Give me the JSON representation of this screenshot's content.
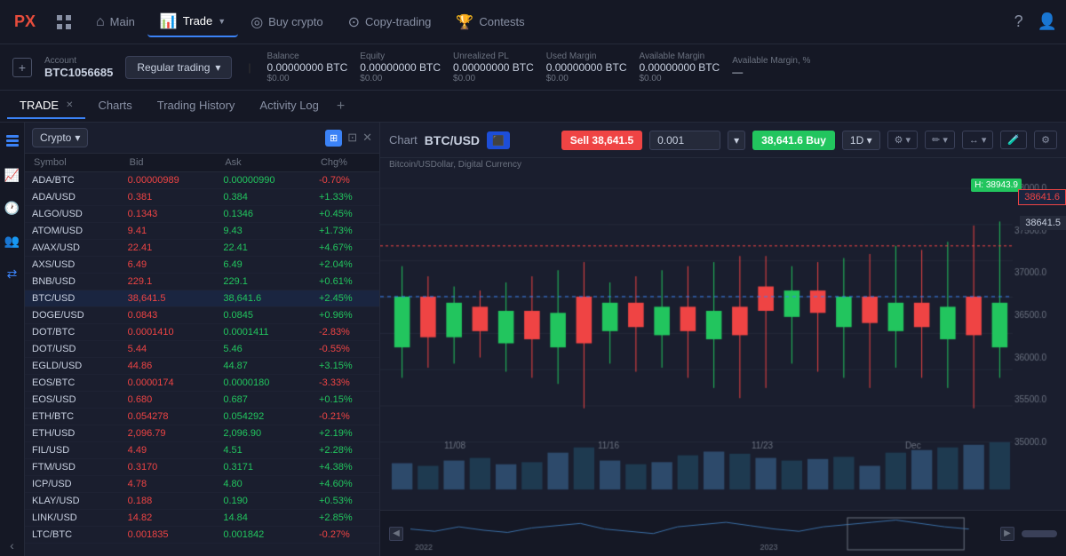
{
  "nav": {
    "logo": "PX",
    "items": [
      {
        "label": "Main",
        "icon": "⌂",
        "active": false
      },
      {
        "label": "Trade",
        "icon": "📊",
        "active": true
      },
      {
        "label": "Buy crypto",
        "icon": "◎",
        "active": false
      },
      {
        "label": "Copy-trading",
        "icon": "⊙",
        "active": false
      },
      {
        "label": "Contests",
        "icon": "🏆",
        "active": false
      }
    ]
  },
  "account": {
    "label": "Account",
    "id": "BTC1056685",
    "trading_type": "Regular trading",
    "metrics": [
      {
        "label": "Balance",
        "value": "0.00000000 BTC",
        "usd": "$0.00"
      },
      {
        "label": "Equity",
        "value": "0.00000000 BTC",
        "usd": "$0.00"
      },
      {
        "label": "Unrealized PL",
        "value": "0.00000000 BTC",
        "usd": "$0.00"
      },
      {
        "label": "Used Margin",
        "value": "0.00000000 BTC",
        "usd": "$0.00"
      },
      {
        "label": "Available Margin",
        "value": "0.00000000 BTC",
        "usd": "$0.00"
      },
      {
        "label": "Available Margin, %",
        "value": "—"
      }
    ]
  },
  "tabs": [
    {
      "label": "TRADE",
      "closable": true,
      "active": true
    },
    {
      "label": "Charts",
      "closable": false,
      "active": false
    },
    {
      "label": "Trading History",
      "closable": false,
      "active": false
    },
    {
      "label": "Activity Log",
      "closable": false,
      "active": false
    }
  ],
  "symbol_panel": {
    "category": "Crypto",
    "headers": [
      "Symbol",
      "Bid",
      "Ask",
      "Chg%"
    ],
    "rows": [
      {
        "symbol": "ADA/BTC",
        "bid": "0.00000989",
        "ask": "0.00000990",
        "chg": "-0.70%",
        "positive": false,
        "active": false
      },
      {
        "symbol": "ADA/USD",
        "bid": "0.381",
        "ask": "0.384",
        "chg": "+1.33%",
        "positive": true,
        "active": false
      },
      {
        "symbol": "ALGO/USD",
        "bid": "0.1343",
        "ask": "0.1346",
        "chg": "+0.45%",
        "positive": true,
        "active": false
      },
      {
        "symbol": "ATOM/USD",
        "bid": "9.41",
        "ask": "9.43",
        "chg": "+1.73%",
        "positive": true,
        "active": false
      },
      {
        "symbol": "AVAX/USD",
        "bid": "22.41",
        "ask": "22.41",
        "chg": "+4.67%",
        "positive": true,
        "active": false
      },
      {
        "symbol": "AXS/USD",
        "bid": "6.49",
        "ask": "6.49",
        "chg": "+2.04%",
        "positive": true,
        "active": false
      },
      {
        "symbol": "BNB/USD",
        "bid": "229.1",
        "ask": "229.1",
        "chg": "+0.61%",
        "positive": true,
        "active": false
      },
      {
        "symbol": "BTC/USD",
        "bid": "38,641.5",
        "ask": "38,641.6",
        "chg": "+2.45%",
        "positive": true,
        "active": true
      },
      {
        "symbol": "DOGE/USD",
        "bid": "0.0843",
        "ask": "0.0845",
        "chg": "+0.96%",
        "positive": true,
        "active": false
      },
      {
        "symbol": "DOT/BTC",
        "bid": "0.0001410",
        "ask": "0.0001411",
        "chg": "-2.83%",
        "positive": false,
        "active": false
      },
      {
        "symbol": "DOT/USD",
        "bid": "5.44",
        "ask": "5.46",
        "chg": "-0.55%",
        "positive": false,
        "active": false
      },
      {
        "symbol": "EGLD/USD",
        "bid": "44.86",
        "ask": "44.87",
        "chg": "+3.15%",
        "positive": true,
        "active": false
      },
      {
        "symbol": "EOS/BTC",
        "bid": "0.0000174",
        "ask": "0.0000180",
        "chg": "-3.33%",
        "positive": false,
        "active": false
      },
      {
        "symbol": "EOS/USD",
        "bid": "0.680",
        "ask": "0.687",
        "chg": "+0.15%",
        "positive": true,
        "active": false
      },
      {
        "symbol": "ETH/BTC",
        "bid": "0.054278",
        "ask": "0.054292",
        "chg": "-0.21%",
        "positive": false,
        "active": false
      },
      {
        "symbol": "ETH/USD",
        "bid": "2,096.79",
        "ask": "2,096.90",
        "chg": "+2.19%",
        "positive": true,
        "active": false
      },
      {
        "symbol": "FIL/USD",
        "bid": "4.49",
        "ask": "4.51",
        "chg": "+2.28%",
        "positive": true,
        "active": false
      },
      {
        "symbol": "FTM/USD",
        "bid": "0.3170",
        "ask": "0.3171",
        "chg": "+4.38%",
        "positive": true,
        "active": false
      },
      {
        "symbol": "ICP/USD",
        "bid": "4.78",
        "ask": "4.80",
        "chg": "+4.60%",
        "positive": true,
        "active": false
      },
      {
        "symbol": "KLAY/USD",
        "bid": "0.188",
        "ask": "0.190",
        "chg": "+0.53%",
        "positive": true,
        "active": false
      },
      {
        "symbol": "LINK/USD",
        "bid": "14.82",
        "ask": "14.84",
        "chg": "+2.85%",
        "positive": true,
        "active": false
      },
      {
        "symbol": "LTC/BTC",
        "bid": "0.001835",
        "ask": "0.001842",
        "chg": "-0.27%",
        "positive": false,
        "active": false
      }
    ]
  },
  "chart": {
    "title": "Chart",
    "symbol": "BTC/USD",
    "subtitle": "Bitcoin/USDollar, Digital Currency",
    "sell_price": "38,641.5",
    "buy_price": "38,641.6",
    "amount": "0.001",
    "timeframe": "1D",
    "price_high": "H: 38943.9",
    "price_tag1": "38641.6",
    "price_tag2": "38641.5",
    "x_labels": [
      "11/08",
      "11/16",
      "11/23",
      "Dec"
    ],
    "y_labels": [
      "38000.0",
      "37500.0",
      "37000.0",
      "36500.0",
      "36000.0",
      "35500.0",
      "35000.0"
    ],
    "bottom_labels": [
      "2022",
      "2023"
    ],
    "candles": [
      {
        "open": 55,
        "close": 80,
        "high": 40,
        "low": 95,
        "green": true
      },
      {
        "open": 75,
        "close": 55,
        "high": 45,
        "low": 90,
        "green": false
      },
      {
        "open": 58,
        "close": 75,
        "high": 50,
        "low": 88,
        "green": true
      },
      {
        "open": 72,
        "close": 60,
        "high": 52,
        "low": 85,
        "green": false
      },
      {
        "open": 62,
        "close": 78,
        "high": 48,
        "low": 92,
        "green": true
      },
      {
        "open": 76,
        "close": 62,
        "high": 45,
        "low": 95,
        "green": false
      },
      {
        "open": 63,
        "close": 80,
        "high": 42,
        "low": 98,
        "green": true
      },
      {
        "open": 78,
        "close": 55,
        "high": 38,
        "low": 110,
        "green": false
      },
      {
        "open": 58,
        "close": 72,
        "high": 48,
        "low": 88,
        "green": true
      },
      {
        "open": 70,
        "close": 58,
        "high": 45,
        "low": 92,
        "green": false
      },
      {
        "open": 60,
        "close": 74,
        "high": 42,
        "low": 90,
        "green": true
      },
      {
        "open": 72,
        "close": 60,
        "high": 40,
        "low": 95,
        "green": false
      },
      {
        "open": 62,
        "close": 76,
        "high": 38,
        "low": 100,
        "green": true
      },
      {
        "open": 74,
        "close": 60,
        "high": 35,
        "low": 105,
        "green": false
      },
      {
        "open": 62,
        "close": 50,
        "high": 35,
        "low": 100,
        "green": false
      },
      {
        "open": 52,
        "close": 65,
        "high": 40,
        "low": 88,
        "green": true
      },
      {
        "open": 63,
        "close": 52,
        "high": 38,
        "low": 92,
        "green": false
      },
      {
        "open": 55,
        "close": 70,
        "high": 36,
        "low": 95,
        "green": true
      },
      {
        "open": 68,
        "close": 55,
        "high": 34,
        "low": 100,
        "green": false
      },
      {
        "open": 58,
        "close": 72,
        "high": 30,
        "low": 90,
        "green": true
      },
      {
        "open": 70,
        "close": 58,
        "high": 32,
        "low": 95,
        "green": false
      },
      {
        "open": 60,
        "close": 76,
        "high": 28,
        "low": 100,
        "green": true
      },
      {
        "open": 74,
        "close": 55,
        "high": 20,
        "low": 110,
        "green": false
      },
      {
        "open": 58,
        "close": 80,
        "high": 18,
        "low": 95,
        "green": true
      }
    ],
    "volumes": [
      50,
      45,
      55,
      60,
      48,
      52,
      70,
      80,
      55,
      48,
      52,
      65,
      72,
      68,
      60,
      55,
      58,
      62,
      45,
      70,
      75,
      80,
      85,
      90
    ]
  }
}
